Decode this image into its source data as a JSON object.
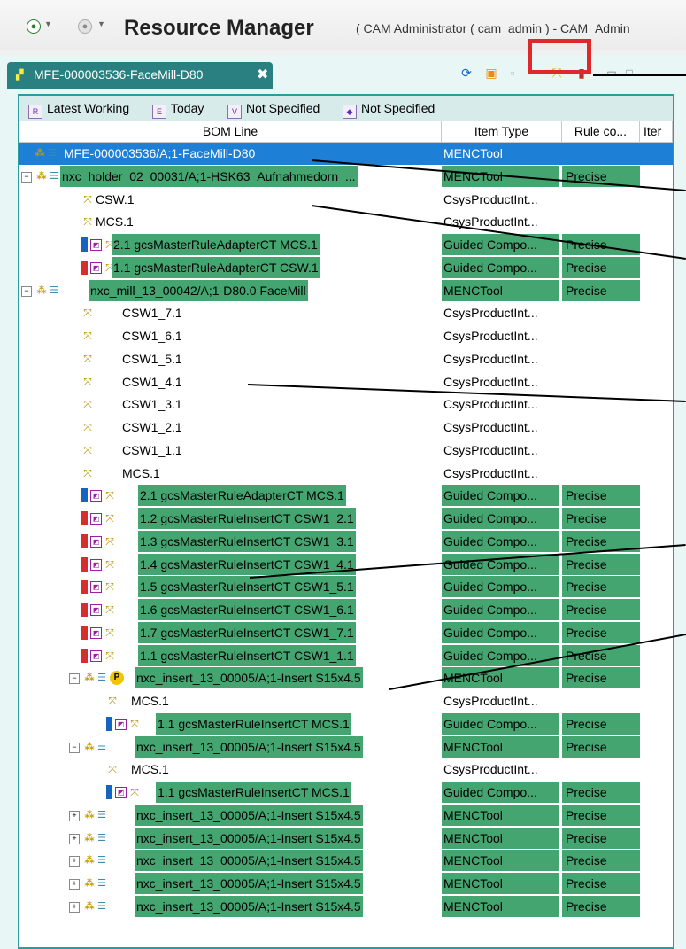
{
  "titlebar": {
    "home_icon": "globe-icon",
    "back_icon": "back-icon",
    "title": "Resource Manager",
    "subtitle": "( CAM Administrator ( cam_admin ) - CAM_Admin"
  },
  "tab": {
    "label": "MFE-000003536-FaceMill-D80",
    "close_glyph": "✖"
  },
  "filters": [
    {
      "label": "Latest Working"
    },
    {
      "label": "Today"
    },
    {
      "label": "Not Specified"
    },
    {
      "label": "Not Specified"
    }
  ],
  "columns": [
    "BOM Line",
    "Item Type",
    "Rule co...",
    "Iter"
  ],
  "rows": [
    {
      "label": "MFE-000003536/A;1-FaceMill-D80",
      "type": "MENCTool",
      "rule": "",
      "icons": "item",
      "selected": true
    },
    {
      "label": "nxc_holder_02_00031/A;1-HSK63_Aufnahmedorn_...",
      "type": "MENCTool",
      "rule": "Precise",
      "icons": "item",
      "green": true,
      "expand": "-"
    },
    {
      "label": "CSW.1",
      "type": "CsysProductInt...",
      "rule": "",
      "icons": "csys"
    },
    {
      "label": "MCS.1",
      "type": "CsysProductInt...",
      "rule": "",
      "icons": "csys"
    },
    {
      "label": "2.1 gcsMasterRuleAdapterCT MCS.1",
      "type": "Guided Compo...",
      "rule": "Precise",
      "icons": "rule-blue",
      "green": true
    },
    {
      "label": "1.1 gcsMasterRuleAdapterCT CSW.1",
      "type": "Guided Compo...",
      "rule": "Precise",
      "icons": "rule-red",
      "green": true
    },
    {
      "label": "nxc_mill_13_00042/A;1-D80.0 FaceMill",
      "type": "MENCTool",
      "rule": "Precise",
      "icons": "item",
      "green": true,
      "expand": "-"
    },
    {
      "label": "CSW1_7.1",
      "type": "CsysProductInt...",
      "rule": "",
      "icons": "csys"
    },
    {
      "label": "CSW1_6.1",
      "type": "CsysProductInt...",
      "rule": "",
      "icons": "csys"
    },
    {
      "label": "CSW1_5.1",
      "type": "CsysProductInt...",
      "rule": "",
      "icons": "csys"
    },
    {
      "label": "CSW1_4.1",
      "type": "CsysProductInt...",
      "rule": "",
      "icons": "csys"
    },
    {
      "label": "CSW1_3.1",
      "type": "CsysProductInt...",
      "rule": "",
      "icons": "csys"
    },
    {
      "label": "CSW1_2.1",
      "type": "CsysProductInt...",
      "rule": "",
      "icons": "csys"
    },
    {
      "label": "CSW1_1.1",
      "type": "CsysProductInt...",
      "rule": "",
      "icons": "csys"
    },
    {
      "label": "MCS.1",
      "type": "CsysProductInt...",
      "rule": "",
      "icons": "csys"
    },
    {
      "label": "2.1 gcsMasterRuleAdapterCT MCS.1",
      "type": "Guided Compo...",
      "rule": "Precise",
      "icons": "rule-blue",
      "green": true
    },
    {
      "label": "1.2 gcsMasterRuleInsertCT CSW1_2.1",
      "type": "Guided Compo...",
      "rule": "Precise",
      "icons": "rule-red",
      "green": true
    },
    {
      "label": "1.3 gcsMasterRuleInsertCT CSW1_3.1",
      "type": "Guided Compo...",
      "rule": "Precise",
      "icons": "rule-red",
      "green": true
    },
    {
      "label": "1.4 gcsMasterRuleInsertCT CSW1_4.1",
      "type": "Guided Compo...",
      "rule": "Precise",
      "icons": "rule-red",
      "green": true
    },
    {
      "label": "1.5 gcsMasterRuleInsertCT CSW1_5.1",
      "type": "Guided Compo...",
      "rule": "Precise",
      "icons": "rule-red",
      "green": true
    },
    {
      "label": "1.6 gcsMasterRuleInsertCT CSW1_6.1",
      "type": "Guided Compo...",
      "rule": "Precise",
      "icons": "rule-red",
      "green": true
    },
    {
      "label": "1.7 gcsMasterRuleInsertCT CSW1_7.1",
      "type": "Guided Compo...",
      "rule": "Precise",
      "icons": "rule-red",
      "green": true
    },
    {
      "label": "1.1 gcsMasterRuleInsertCT CSW1_1.1",
      "type": "Guided Compo...",
      "rule": "Precise",
      "icons": "rule-red",
      "green": true
    },
    {
      "label": "nxc_insert_13_00005/A;1-Insert S15x4.5",
      "type": "MENCTool",
      "rule": "Precise",
      "icons": "item-p",
      "green": true,
      "expand": "-"
    },
    {
      "label": "MCS.1",
      "type": "CsysProductInt...",
      "rule": "",
      "icons": "csys"
    },
    {
      "label": "1.1 gcsMasterRuleInsertCT MCS.1",
      "type": "Guided Compo...",
      "rule": "Precise",
      "icons": "rule-blue",
      "green": true
    },
    {
      "label": "nxc_insert_13_00005/A;1-Insert S15x4.5",
      "type": "MENCTool",
      "rule": "Precise",
      "icons": "item",
      "green": true,
      "expand": "-"
    },
    {
      "label": "MCS.1",
      "type": "CsysProductInt...",
      "rule": "",
      "icons": "csys"
    },
    {
      "label": "1.1 gcsMasterRuleInsertCT MCS.1",
      "type": "Guided Compo...",
      "rule": "Precise",
      "icons": "rule-blue",
      "green": true
    },
    {
      "label": "nxc_insert_13_00005/A;1-Insert S15x4.5",
      "type": "MENCTool",
      "rule": "Precise",
      "icons": "item",
      "green": true,
      "expand": "+"
    },
    {
      "label": "nxc_insert_13_00005/A;1-Insert S15x4.5",
      "type": "MENCTool",
      "rule": "Precise",
      "icons": "item",
      "green": true,
      "expand": "+"
    },
    {
      "label": "nxc_insert_13_00005/A;1-Insert S15x4.5",
      "type": "MENCTool",
      "rule": "Precise",
      "icons": "item",
      "green": true,
      "expand": "+"
    },
    {
      "label": "nxc_insert_13_00005/A;1-Insert S15x4.5",
      "type": "MENCTool",
      "rule": "Precise",
      "icons": "item",
      "green": true,
      "expand": "+"
    },
    {
      "label": "nxc_insert_13_00005/A;1-Insert S15x4.5",
      "type": "MENCTool",
      "rule": "Precise",
      "icons": "item",
      "green": true,
      "expand": "+"
    }
  ],
  "colors": {
    "selection": "#1e7fd6",
    "rule_highlight": "#45a571",
    "annotation_box": "#e0282b",
    "tab": "#2a8080"
  }
}
